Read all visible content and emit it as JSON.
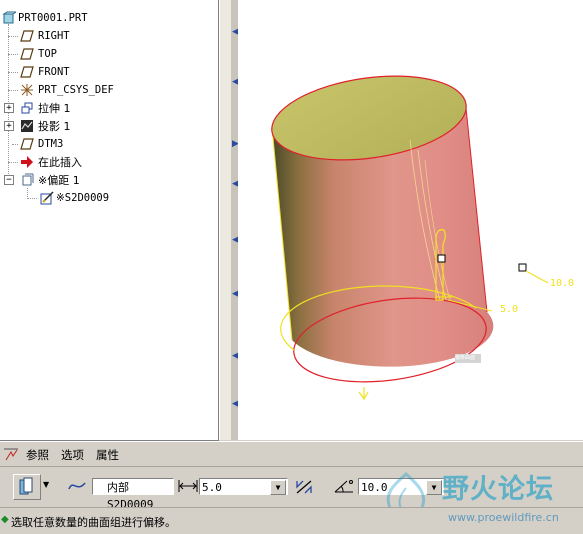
{
  "model_tree": {
    "items": [
      {
        "label": "PRT0001.PRT",
        "icon": "part-icon"
      },
      {
        "label": "RIGHT",
        "icon": "datum-plane-icon"
      },
      {
        "label": "TOP",
        "icon": "datum-plane-icon"
      },
      {
        "label": "FRONT",
        "icon": "datum-plane-icon"
      },
      {
        "label": "PRT_CSYS_DEF",
        "icon": "coordinate-system-icon"
      },
      {
        "label": "拉伸 1",
        "icon": "extrude-icon"
      },
      {
        "label": "投影 1",
        "icon": "project-curve-icon"
      },
      {
        "label": "DTM3",
        "icon": "datum-plane-icon"
      },
      {
        "label": "在此插入",
        "icon": "insert-here-arrow-icon"
      },
      {
        "label": "※偏距 1",
        "icon": "offset-feature-icon"
      },
      {
        "label": "※S2D0009",
        "icon": "sketch-icon"
      }
    ]
  },
  "viewport": {
    "dimensions": {
      "offset_value": "5.0",
      "angle_value": "10.0"
    },
    "tag_label": "偏移曲面"
  },
  "dashboard": {
    "tabs": [
      "参照",
      "选项",
      "属性"
    ],
    "sketch_field": "内部S2D0009",
    "distance_value": "5.0",
    "angle_value": "10.0"
  },
  "status": {
    "message": "选取任意数量的曲面组进行偏移。"
  },
  "watermark": {
    "title": "野火论坛",
    "url": "www.proewildfire.cn"
  },
  "colors": {
    "surface": "#d68f86",
    "top_face": "#c8c46a",
    "edge_red": "#e0202a",
    "edge_yellow": "#f0e020"
  }
}
